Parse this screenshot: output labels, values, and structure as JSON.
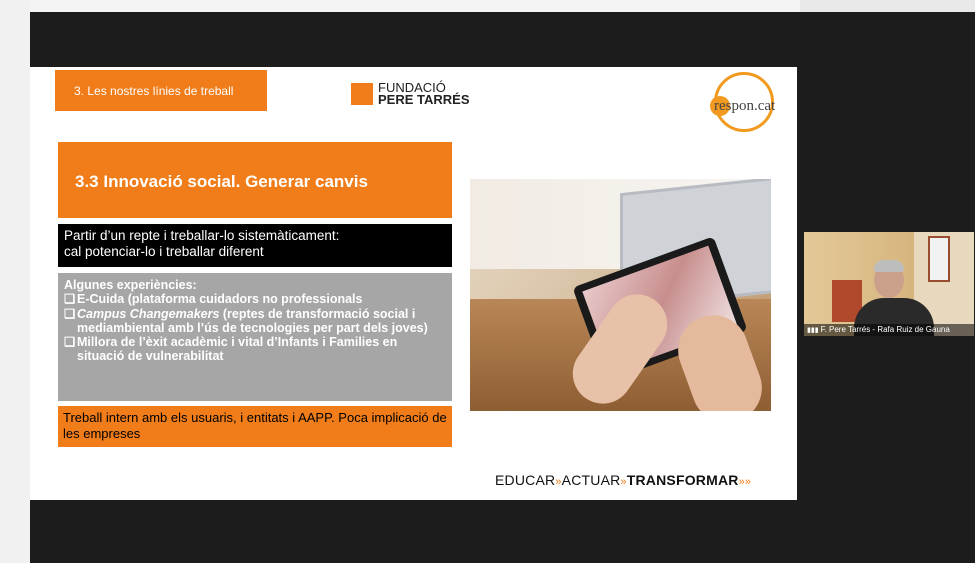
{
  "slide": {
    "section_tag": "3. Les nostres línies de treball",
    "fpt_logo_line1": "FUNDACIÓ",
    "fpt_logo_line2": "PERE TARRÉS",
    "respon_logo": "respon.cat",
    "title": "3.3 Innovació social. Generar canvis",
    "black_box_line1": "Partir d’un repte i treballar-lo sistemàticament:",
    "black_box_line2": "cal potenciar-lo i treballar diferent",
    "grey_box": {
      "heading": "Algunes experiències:",
      "bullet": "❑",
      "item1": "E-Cuida (plataforma cuidadors no professionals",
      "item2_italic": "Campus Changemakers",
      "item2_rest": " (reptes de transformació social i mediambiental amb l’ús de tecnologies per part dels joves)",
      "item3": "Millora de l’èxit acadèmic i vital d’Infants i Families en situació de vulnerabilitat"
    },
    "orange_box": "Treball intern amb els usuaris, i entitats i AAPP. Poca implicació de les empreses",
    "footer": {
      "w1": "EDUCAR",
      "w2": "ACTUAR",
      "w3": "TRANSFORMAR",
      "arrow": "»",
      "end_arrows": "»»"
    }
  },
  "participant": {
    "label": "F. Pere Tarrés - Rafa Ruiz de Gauna",
    "signal_icon": "signal-bars-icon"
  },
  "colors": {
    "accent_orange": "#f07d19",
    "respon_orange": "#f29a1f",
    "grey_box": "#a6a6a6"
  }
}
